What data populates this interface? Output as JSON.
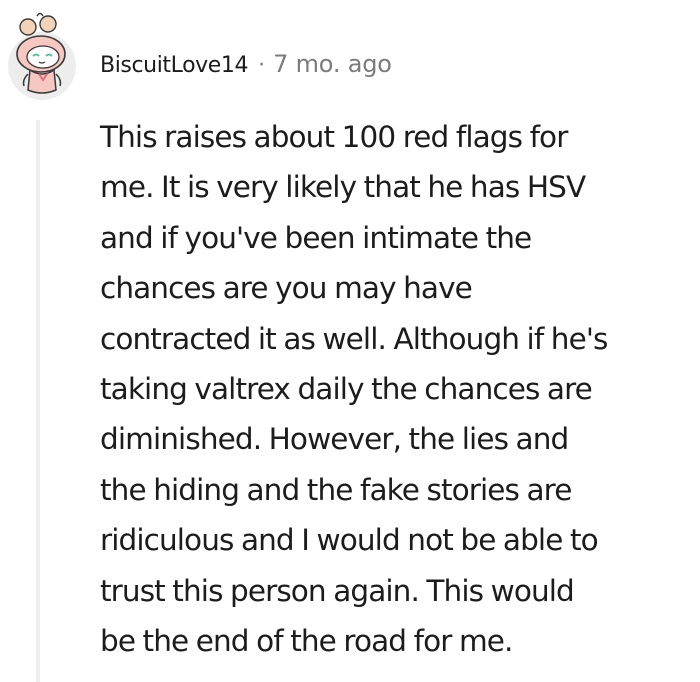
{
  "comment": {
    "username": "BiscuitLove14",
    "separator": "·",
    "timestamp": "7 mo. ago",
    "body_lines": [
      "This raises about 100 red flags for",
      "me. It is very likely that he has HSV",
      "and if you've been intimate the",
      "chances are you may have",
      "contracted it as well. Although if he's",
      "taking valtrex daily the chances are",
      "diminished. However, the lies and",
      "the hiding and the fake stories are",
      "ridiculous and I would not be able to",
      "trust this person again. This would",
      "be the end of the road for me."
    ]
  },
  "colors": {
    "text": "#1c1c1c",
    "meta": "#7c7c7c",
    "thread_line": "#edeff1",
    "avatar_bg": "#ededed",
    "avatar_hat": "#f7c8c2",
    "avatar_accent": "#e86b7d",
    "avatar_eyes": "#53c0a0"
  },
  "icons": {
    "avatar": "snoo-avatar-icon"
  }
}
